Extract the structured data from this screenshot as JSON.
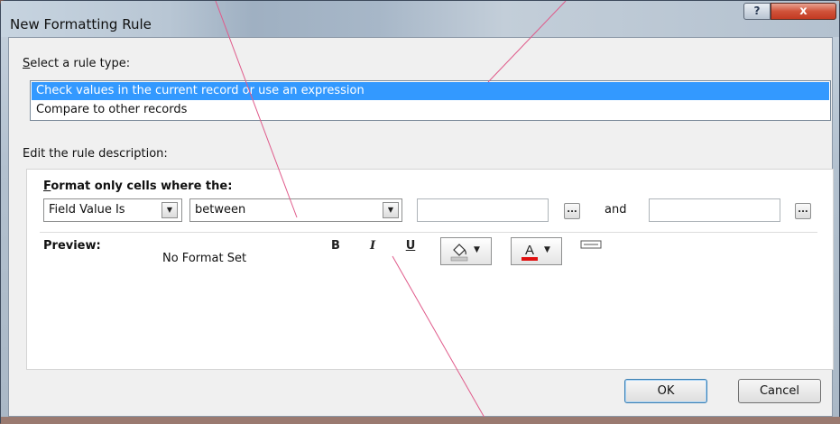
{
  "dialog": {
    "title": "New Formatting Rule",
    "help_label": "?",
    "close_label": "x"
  },
  "rule_type": {
    "label_first": "S",
    "label_rest": "elect a rule type:",
    "items": [
      {
        "label": "Check values in the current record or use an expression",
        "selected": true
      },
      {
        "label": "Compare to other records",
        "selected": false
      }
    ]
  },
  "description": {
    "label": "Edit the rule description:",
    "format_label_first": "F",
    "format_label_rest": "ormat only cells where the:",
    "field_combo": {
      "value": "Field Value Is"
    },
    "operator_combo": {
      "value": "between"
    },
    "value1": "",
    "value2": "",
    "and_label": "and",
    "ellipsis_label": "...",
    "preview_label": "Preview:",
    "preview_text": "No Format Set",
    "bold_label": "B",
    "italic_label": "I",
    "underline_label": "U"
  },
  "buttons": {
    "ok": "OK",
    "cancel": "Cancel"
  },
  "colors": {
    "selection": "#3399ff",
    "font_color_bar": "#e01010",
    "annotation_line": "#e05a8a"
  },
  "icons": {
    "fill": "paint-bucket-icon",
    "font_color": "font-color-icon",
    "arrow": "chevron-down-icon"
  }
}
